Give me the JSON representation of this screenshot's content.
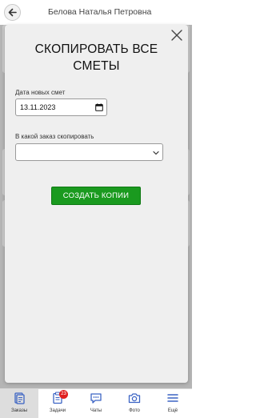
{
  "header": {
    "title": "Белова Наталья Петровна"
  },
  "modal": {
    "title": "СКОПИРОВАТЬ ВСЕ СМЕТЫ",
    "date_label": "Дата новых смет",
    "date_value": "13.11.2023",
    "order_label": "В какой заказ скопировать",
    "order_value": "",
    "copy_button": "СОЗДАТЬ КОПИИ"
  },
  "bottom_nav": {
    "items": [
      {
        "label": "Заказы",
        "icon": "orders-icon",
        "active": true
      },
      {
        "label": "Задачи",
        "icon": "tasks-icon",
        "badge": "23"
      },
      {
        "label": "Чаты",
        "icon": "chat-icon"
      },
      {
        "label": "Фото",
        "icon": "camera-icon"
      },
      {
        "label": "Ещё",
        "icon": "menu-icon"
      }
    ]
  },
  "colors": {
    "accent_blue": "#3b63c4",
    "button_green": "#1a9a1f",
    "badge_red": "#e02020"
  }
}
